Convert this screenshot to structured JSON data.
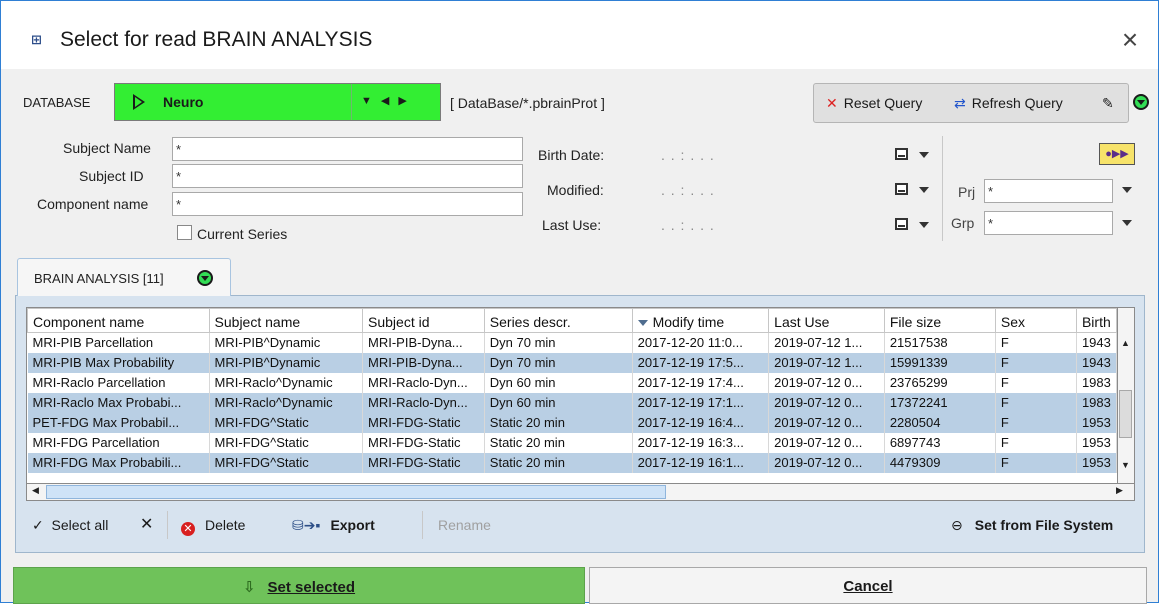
{
  "window": {
    "title": "Select for read BRAIN ANALYSIS",
    "close": "×"
  },
  "database": {
    "label": "DATABASE",
    "name": "Neuro",
    "path": "[ DataBase/*.pbrainProt ]",
    "color": "#33ee33"
  },
  "query": {
    "reset": "Reset Query",
    "refresh": "Refresh Query"
  },
  "search": {
    "subject_name_label": "Subject Name",
    "subject_name": "*",
    "subject_id_label": "Subject ID",
    "subject_id": "*",
    "component_name_label": "Component name",
    "component_name": "*",
    "current_series_label": "Current Series",
    "birth_date_label": "Birth Date:",
    "modified_label": "Modified:",
    "last_use_label": "Last Use:",
    "date_placeholder": ".    .    :    .    .    .",
    "prj_label": "Prj",
    "prj": "*",
    "grp_label": "Grp",
    "grp": "*"
  },
  "tab": {
    "label": "BRAIN ANALYSIS [11]"
  },
  "table": {
    "columns": [
      "Component name",
      "Subject name",
      "Subject id",
      "Series descr.",
      "Modify time",
      "Last Use",
      "File size",
      "Sex",
      "Birth"
    ],
    "rows": [
      [
        "MRI-PIB Parcellation",
        "MRI-PIB^Dynamic",
        "MRI-PIB-Dyna...",
        "Dyn 70 min",
        "2017-12-20 11:0...",
        "2019-07-12 1...",
        "21517538",
        "F",
        "1943"
      ],
      [
        "MRI-PIB Max Probability",
        "MRI-PIB^Dynamic",
        "MRI-PIB-Dyna...",
        "Dyn 70 min",
        "2017-12-19 17:5...",
        "2019-07-12 1...",
        "15991339",
        "F",
        "1943"
      ],
      [
        "MRI-Raclo Parcellation",
        "MRI-Raclo^Dynamic",
        "MRI-Raclo-Dyn...",
        "Dyn 60 min",
        "2017-12-19 17:4...",
        "2019-07-12 0...",
        "23765299",
        "F",
        "1983"
      ],
      [
        "MRI-Raclo Max Probabi...",
        "MRI-Raclo^Dynamic",
        "MRI-Raclo-Dyn...",
        "Dyn 60 min",
        "2017-12-19 17:1...",
        "2019-07-12 0...",
        "17372241",
        "F",
        "1983"
      ],
      [
        "PET-FDG Max Probabil...",
        "MRI-FDG^Static",
        "MRI-FDG-Static",
        "Static 20 min",
        "2017-12-19 16:4...",
        "2019-07-12 0...",
        "2280504",
        "F",
        "1953"
      ],
      [
        "MRI-FDG Parcellation",
        "MRI-FDG^Static",
        "MRI-FDG-Static",
        "Static 20 min",
        "2017-12-19 16:3...",
        "2019-07-12 0...",
        "6897743",
        "F",
        "1953"
      ],
      [
        "MRI-FDG Max Probabili...",
        "MRI-FDG^Static",
        "MRI-FDG-Static",
        "Static 20 min",
        "2017-12-19 16:1...",
        "2019-07-12 0...",
        "4479309",
        "F",
        "1953"
      ]
    ],
    "selected_rows": [
      1,
      3,
      4,
      6
    ]
  },
  "toolbar": {
    "select_all": "Select all",
    "delete": "Delete",
    "export": "Export",
    "rename": "Rename",
    "set_from_fs": "Set from File System"
  },
  "footer": {
    "set_selected": "Set selected",
    "cancel": "Cancel"
  }
}
